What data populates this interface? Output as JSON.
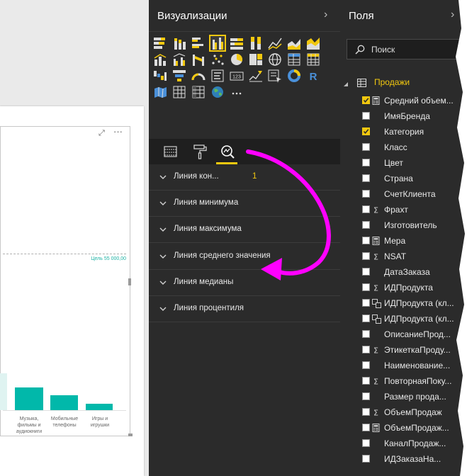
{
  "visual": {
    "target_label": "Цель 55 000,00",
    "more_glyph": "···",
    "expand_glyph": "⤢",
    "categories": [
      "Музыка,\nфильмы и\nаудиокниги",
      "Мобильные\nтелефоны",
      "Игры и\nигрушки"
    ]
  },
  "viz_pane": {
    "title": "Визуализации",
    "chevron": "›",
    "icons": [
      "stacked-bar-chart-icon",
      "stacked-column-chart-icon",
      "clustered-bar-chart-icon",
      "clustered-column-chart-icon",
      "100-stacked-bar-chart-icon",
      "100-stacked-column-chart-icon",
      "line-chart-icon",
      "area-chart-icon",
      "stacked-area-chart-icon",
      "line-and-stacked-column-chart-icon",
      "line-and-clustered-column-chart-icon",
      "ribbon-chart-icon",
      "scatter-chart-icon",
      "pie-chart-icon",
      "treemap-icon",
      "map-icon",
      "table-icon",
      "matrix-icon",
      "waterfall-chart-icon",
      "funnel-chart-icon",
      "gauge-icon",
      "multi-row-card-icon",
      "card-icon",
      "kpi-icon",
      "slicer-icon",
      "donut-chart-icon",
      "r-script-visual-icon",
      "filled-map-icon",
      "table-visual-icon",
      "matrix-visual-icon",
      "globe-map-icon",
      "more-visuals-icon"
    ],
    "selected_icon": "clustered-column-chart-icon",
    "tabs": [
      "fields-tab-icon",
      "format-tab-icon",
      "analytics-tab-icon"
    ],
    "analytics_lines": [
      {
        "label": "Линия кон...",
        "count": "1"
      },
      {
        "label": "Линия минимума",
        "count": ""
      },
      {
        "label": "Линия максимума",
        "count": ""
      },
      {
        "label": "Линия среднего значения",
        "count": ""
      },
      {
        "label": "Линия медианы",
        "count": ""
      },
      {
        "label": "Линия процентиля",
        "count": ""
      }
    ]
  },
  "fields_pane": {
    "title": "Поля",
    "chevron": "›",
    "search_placeholder": "Поиск",
    "table_name": "Продажи",
    "fields": [
      {
        "name": "Средний объем...",
        "checked": true,
        "icon": "calculator-icon"
      },
      {
        "name": "ИмяБренда",
        "checked": false,
        "icon": ""
      },
      {
        "name": "Категория",
        "checked": true,
        "icon": ""
      },
      {
        "name": "Класс",
        "checked": false,
        "icon": ""
      },
      {
        "name": "Цвет",
        "checked": false,
        "icon": ""
      },
      {
        "name": "Страна",
        "checked": false,
        "icon": ""
      },
      {
        "name": "СчетКлиента",
        "checked": false,
        "icon": ""
      },
      {
        "name": "Фрахт",
        "checked": false,
        "icon": "sigma-icon"
      },
      {
        "name": "Изготовитель",
        "checked": false,
        "icon": ""
      },
      {
        "name": "Мера",
        "checked": false,
        "icon": "calculator-icon"
      },
      {
        "name": "NSAT",
        "checked": false,
        "icon": "sigma-icon"
      },
      {
        "name": "ДатаЗаказа",
        "checked": false,
        "icon": ""
      },
      {
        "name": "ИДПродукта",
        "checked": false,
        "icon": "sigma-icon"
      },
      {
        "name": "ИДПродукта (кл...",
        "checked": false,
        "icon": "hierarchy-icon"
      },
      {
        "name": "ИДПродукта (кл...",
        "checked": false,
        "icon": "hierarchy-icon"
      },
      {
        "name": "ОписаниеПрод...",
        "checked": false,
        "icon": ""
      },
      {
        "name": "ЭтикеткаПроду...",
        "checked": false,
        "icon": "sigma-icon"
      },
      {
        "name": "Наименование...",
        "checked": false,
        "icon": ""
      },
      {
        "name": "ПовторнаяПоку...",
        "checked": false,
        "icon": "sigma-icon"
      },
      {
        "name": "Размер прода...",
        "checked": false,
        "icon": ""
      },
      {
        "name": "ОбъемПродаж",
        "checked": false,
        "icon": "sigma-icon"
      },
      {
        "name": "ОбъемПродаж...",
        "checked": false,
        "icon": "calculator-icon"
      },
      {
        "name": "КаналПродаж...",
        "checked": false,
        "icon": ""
      },
      {
        "name": "ИДЗаказаНа...",
        "checked": false,
        "icon": ""
      }
    ]
  },
  "colors": {
    "accent": "#f2c80f",
    "bar": "#01b8aa",
    "annotation_arrow": "#ff00ff",
    "pane_bg": "#2b2b2b"
  }
}
